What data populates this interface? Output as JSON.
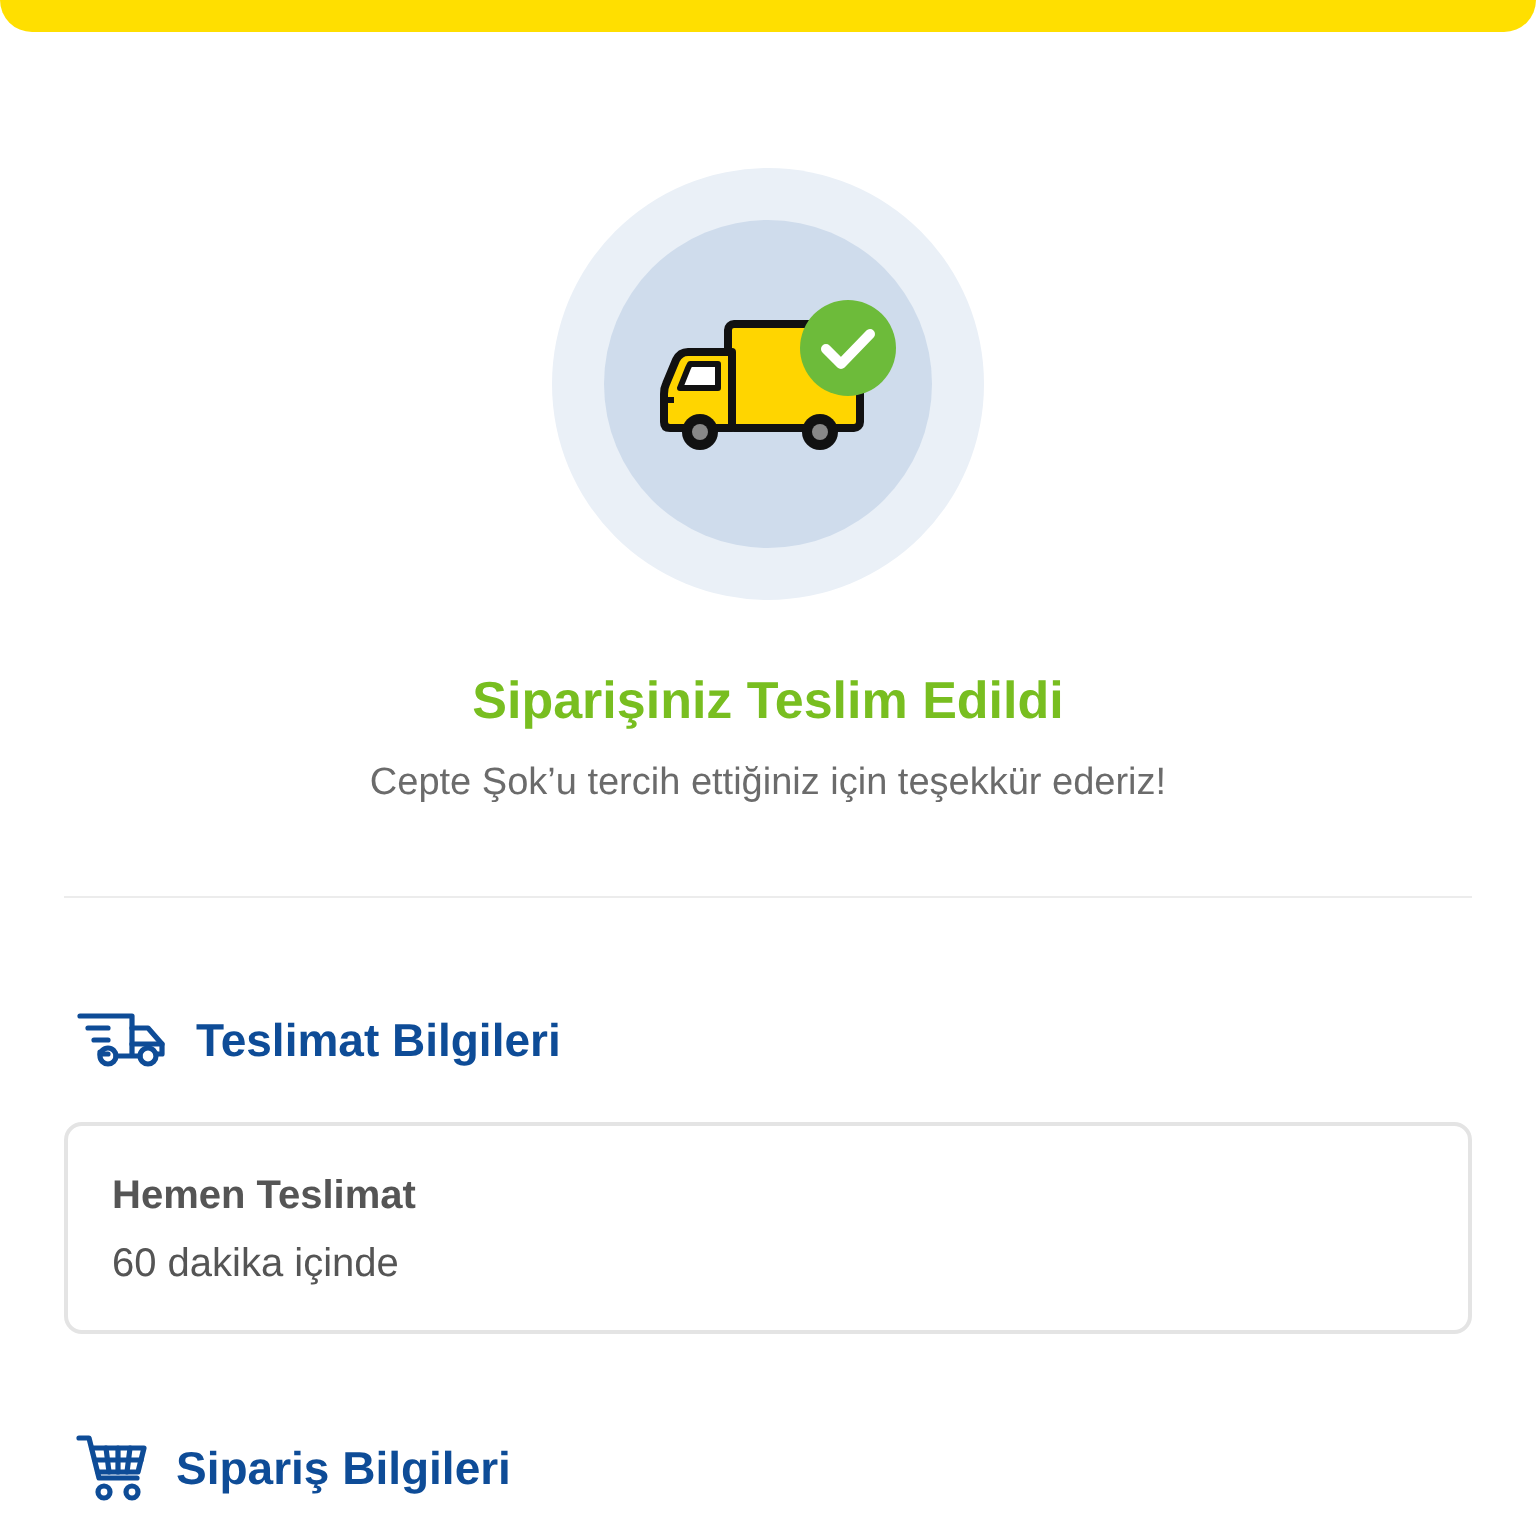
{
  "status": {
    "title": "Siparişiniz Teslim Edildi",
    "message": "Cepte Şok’u tercih ettiğiniz için teşekkür ederiz!"
  },
  "sections": [
    {
      "kind": "delivery",
      "title": "Teslimat Bilgileri",
      "card": {
        "title": "Hemen Teslimat",
        "detail": "60 dakika içinde"
      }
    },
    {
      "kind": "order",
      "title": "Sipariş Bilgileri"
    }
  ]
}
